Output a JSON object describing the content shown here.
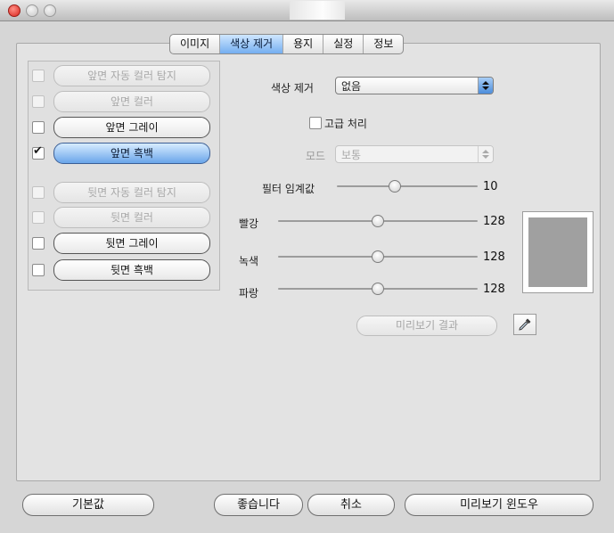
{
  "window": {
    "title": ""
  },
  "tabs": [
    {
      "label": "이미지",
      "active": false
    },
    {
      "label": "색상 제거",
      "active": true
    },
    {
      "label": "용지",
      "active": false
    },
    {
      "label": "실정",
      "active": false
    },
    {
      "label": "정보",
      "active": false
    }
  ],
  "options": [
    {
      "label": "앞면 자동 컬러 탐지",
      "checked": false,
      "enabled": false
    },
    {
      "label": "앞면 컬러",
      "checked": false,
      "enabled": false
    },
    {
      "label": "앞면 그레이",
      "checked": false,
      "enabled": true
    },
    {
      "label": "앞면 흑백",
      "checked": true,
      "enabled": true,
      "selected": true
    },
    {
      "label": "뒷면 자동 컬러 탐지",
      "checked": false,
      "enabled": false
    },
    {
      "label": "뒷면 컬러",
      "checked": false,
      "enabled": false
    },
    {
      "label": "뒷면 그레이",
      "checked": false,
      "enabled": true
    },
    {
      "label": "뒷면 흑백",
      "checked": false,
      "enabled": true
    }
  ],
  "color_drop": {
    "label": "색상 제거",
    "value": "없음"
  },
  "high_quality": {
    "label": "고급 처리",
    "checked": false
  },
  "mode": {
    "label": "모드",
    "value": "보통",
    "enabled": false
  },
  "filter_threshold": {
    "label": "필터 임계값",
    "value": "10",
    "level": 0.4
  },
  "red": {
    "label": "빨강",
    "value": "128",
    "level": 0.5
  },
  "green": {
    "label": "녹색",
    "value": "128",
    "level": 0.5
  },
  "blue": {
    "label": "파랑",
    "value": "128",
    "level": 0.5
  },
  "preview_color": "#a0a0a0",
  "preview_result_button": "미리보기 결과",
  "eyedropper": {
    "icon": "eyedropper-icon"
  },
  "footer": {
    "default_button": "기본값",
    "ok_button": "좋습니다",
    "cancel_button": "취소",
    "preview_window_button": "미리보기 윈도우"
  }
}
